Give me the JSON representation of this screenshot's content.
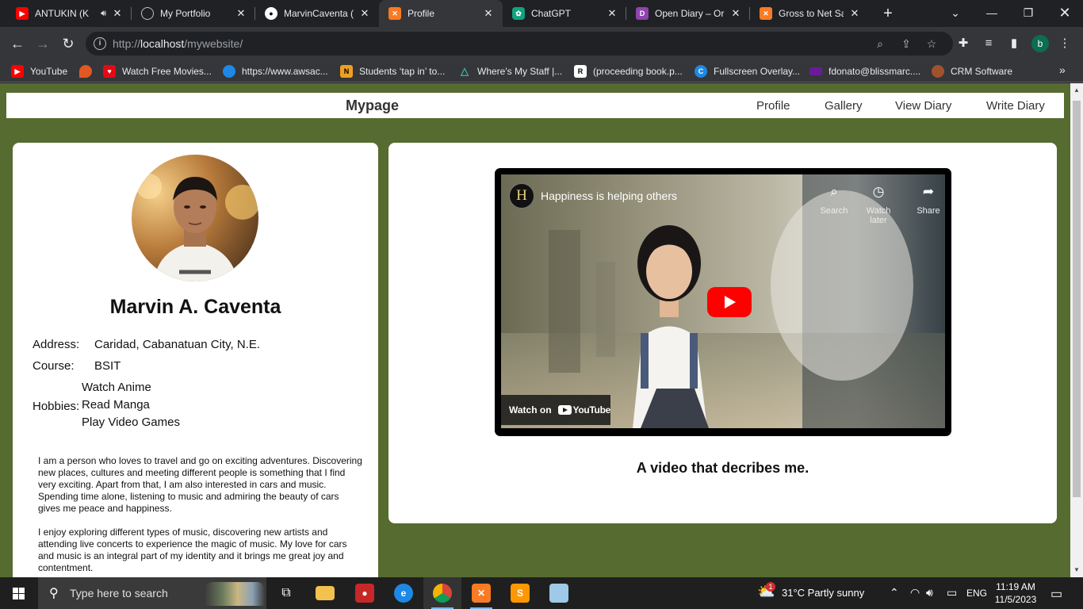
{
  "browser": {
    "tabs": [
      {
        "title": "ANTUKIN (K",
        "icon": "youtube-icon",
        "color": "#ff0000",
        "audio": true
      },
      {
        "title": "My Portfolio",
        "icon": "globe-icon",
        "color": "#5f6368"
      },
      {
        "title": "MarvinCaventa (",
        "icon": "github-icon",
        "color": "#ffffff"
      },
      {
        "title": "Profile",
        "icon": "xampp-icon",
        "color": "#fb7a24",
        "active": true
      },
      {
        "title": "ChatGPT",
        "icon": "chatgpt-icon",
        "color": "#10a37f"
      },
      {
        "title": "Open Diary – Or",
        "icon": "open-diary-icon",
        "color": "#8e44ad"
      },
      {
        "title": "Gross to Net Sal",
        "icon": "xampp-icon",
        "color": "#fb7a24"
      }
    ],
    "url_scheme": "http://",
    "url_host": "localhost",
    "url_path": "/mywebsite/",
    "profile_initial": "b",
    "bookmarks": [
      {
        "label": "YouTube",
        "icon": "youtube-icon",
        "color": "#ff0000"
      },
      {
        "label": "",
        "icon": "flame-icon",
        "color": "#e25822"
      },
      {
        "label": "Watch Free Movies...",
        "icon": "heart-icon",
        "color": "#e50914"
      },
      {
        "label": "https://www.awsac...",
        "icon": "cloud-icon",
        "color": "#1e88e5"
      },
      {
        "label": "Students ‘tap in’ to...",
        "icon": "news-icon",
        "color": "#f0a020"
      },
      {
        "label": "Where's My Staff |...",
        "icon": "triangle-icon",
        "color": "#3ab5a0"
      },
      {
        "label": "(proceeding book.p...",
        "icon": "research-icon",
        "color": "#ffffff"
      },
      {
        "label": "Fullscreen Overlay...",
        "icon": "overlay-icon",
        "color": "#1e88e5"
      },
      {
        "label": "fdonato@blissmarc....",
        "icon": "mail-icon",
        "color": "#6a1b9a"
      },
      {
        "label": "CRM Software",
        "icon": "crm-icon",
        "color": "#a0522d"
      }
    ]
  },
  "site": {
    "brand": "Mypage",
    "nav": [
      "Profile",
      "Gallery",
      "View Diary",
      "Write Diary"
    ],
    "profile": {
      "name": "Marvin A. Caventa",
      "address_label": "Address:",
      "address": "Caridad, Cabanatuan City, N.E.",
      "course_label": "Course:",
      "course": "BSIT",
      "hobbies_label": "Hobbies:",
      "hobbies": [
        "Watch Anime",
        "Read Manga",
        "Play Video Games"
      ],
      "about": [
        "I am a person who loves to travel and go on exciting adventures. Discovering new places, cultures and meeting different people is something that I find very exciting. Apart from that, I am also interested in cars and music. Spending time alone, listening to music and admiring the beauty of cars gives me peace and happiness.",
        "I enjoy exploring different types of music, discovering new artists and attending live concerts to experience the magic of music. My love for cars and music is an integral part of my identity and it brings me great joy and contentment."
      ]
    },
    "video": {
      "channel_initial": "H",
      "title": "Happiness is helping others",
      "actions": [
        {
          "label": "Search",
          "icon": "search-icon"
        },
        {
          "label": "Watch later",
          "icon": "clock-icon"
        },
        {
          "label": "Share",
          "icon": "share-icon"
        }
      ],
      "watch_on": "Watch on",
      "yt_brand": "YouTube",
      "caption": "A video that decribes me."
    },
    "colors": {
      "background": "#566b30",
      "card": "#ffffff",
      "play": "#ff0000"
    }
  },
  "taskbar": {
    "search_placeholder": "Type here to search",
    "weather": "31°C  Partly sunny",
    "weather_badge": "1",
    "language": "ENG",
    "time": "11:19 AM",
    "date": "11/5/2023"
  }
}
